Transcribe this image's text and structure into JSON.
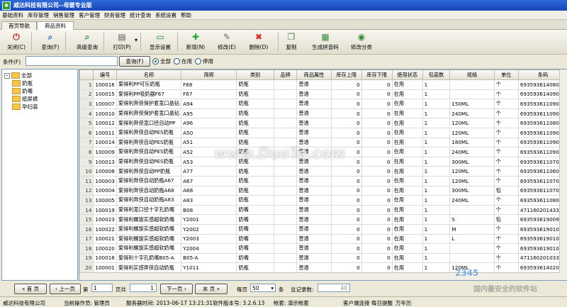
{
  "window": {
    "title": "威达科技有限公司--母婴专业版"
  },
  "menu": [
    "基础资料",
    "库存管理",
    "销售管理",
    "客户管理",
    "财务管理",
    "统计查询",
    "系统设置",
    "帮助"
  ],
  "tabs": [
    "首页导航",
    "商品资料"
  ],
  "toolbar": [
    {
      "label": "关闭(C)",
      "icon": "close-icon",
      "color": "#c0282a"
    },
    {
      "label": "查询(F)",
      "icon": "search-icon",
      "color": "#2f6fb5"
    },
    {
      "label": "高级查询",
      "icon": "advanced-search-icon",
      "color": "#2e9b45"
    },
    {
      "label": "打印(P)",
      "icon": "printer-icon",
      "color": "#555555"
    },
    {
      "label": "显示设置",
      "icon": "display-settings-icon",
      "color": "#2a8a3a"
    },
    {
      "label": "新增(N)",
      "icon": "add-icon",
      "color": "#26a03a"
    },
    {
      "label": "修改(E)",
      "icon": "edit-icon",
      "color": "#6a6a6a"
    },
    {
      "label": "删除(D)",
      "icon": "delete-icon",
      "color": "#d02a2a"
    },
    {
      "label": "复制",
      "icon": "copy-icon",
      "color": "#5a7a5a"
    },
    {
      "label": "生成拼音码",
      "icon": "pinyin-code-icon",
      "color": "#3a8a3a"
    },
    {
      "label": "修改分类",
      "icon": "modify-category-icon",
      "color": "#3a8a3a"
    }
  ],
  "condition": {
    "label": "条件(F)",
    "input_value": "",
    "query_button": "查询(F)",
    "radios": [
      "全部",
      "在用",
      "停用"
    ],
    "selected": 0
  },
  "tree": {
    "root": "全部",
    "children": [
      "奶瓶",
      "奶嘴",
      "纸尿裤",
      "孕妇装"
    ]
  },
  "table": {
    "columns": [
      "",
      "编号",
      "名称",
      "简称",
      "类别",
      "品牌",
      "商品属性",
      "库存上限",
      "库存下限",
      "使用状态",
      "包装数",
      "规格",
      "单位",
      "条码"
    ],
    "rows": [
      [
        "1",
        "100016",
        "爱得利PP可乐奶瓶",
        "F68",
        "奶瓶",
        "",
        "普通",
        "0",
        "0",
        "在用",
        "1",
        "",
        "个",
        "693593614080"
      ],
      [
        "2",
        "100015",
        "爱得利PP吸奶器F67",
        "F67",
        "奶瓶",
        "",
        "普通",
        "0",
        "0",
        "在用",
        "1",
        "",
        "个",
        "693593614090"
      ],
      [
        "3",
        "100007",
        "爱得利奔侠保护套宽口晶钻",
        "A94",
        "奶瓶",
        "",
        "普通",
        "0",
        "0",
        "在用",
        "1",
        "150ML",
        "个",
        "693593611090"
      ],
      [
        "4",
        "100010",
        "爱得利奔侠保护套宽口晶钻",
        "A95",
        "奶瓶",
        "",
        "普通",
        "0",
        "0",
        "在用",
        "1",
        "240ML",
        "个",
        "693593611090"
      ],
      [
        "5",
        "100012",
        "爱得利奔侠宽口径自动PP",
        "A96",
        "奶瓶",
        "",
        "普通",
        "0",
        "0",
        "在用",
        "1",
        "120ML",
        "个",
        "693593611080"
      ],
      [
        "6",
        "100011",
        "爱得利奔侠自动PES奶瓶",
        "A50",
        "奶瓶",
        "",
        "普通",
        "0",
        "0",
        "在用",
        "1",
        "120ML",
        "个",
        "693593611090"
      ],
      [
        "7",
        "100014",
        "爱得利奔侠自动PES奶瓶",
        "A51",
        "奶瓶",
        "",
        "普通",
        "0",
        "0",
        "在用",
        "1",
        "180ML",
        "个",
        "693593611090"
      ],
      [
        "8",
        "100009",
        "爱得利奔侠自动PES奶瓶",
        "A52",
        "奶瓶",
        "",
        "普通",
        "0",
        "0",
        "在用",
        "1",
        "240ML",
        "个",
        "693593611090"
      ],
      [
        "9",
        "100013",
        "爱得利奔侠自动PES奶瓶",
        "A53",
        "奶瓶",
        "",
        "普通",
        "0",
        "0",
        "在用",
        "1",
        "300ML",
        "个",
        "693593611070"
      ],
      [
        "10",
        "100008",
        "爱得利奔侠自动PP奶瓶",
        "A77",
        "奶瓶",
        "",
        "普通",
        "0",
        "0",
        "在用",
        "1",
        "120ML",
        "个",
        "693593611060"
      ],
      [
        "11",
        "100003",
        "爱得利奔侠自动奶瓶A67",
        "A67",
        "奶瓶",
        "",
        "普通",
        "0",
        "0",
        "在用",
        "1",
        "120ML",
        "个",
        "693593611070"
      ],
      [
        "12",
        "100004",
        "爱得利奔侠自动奶瓶A68",
        "A68",
        "奶瓶",
        "",
        "普通",
        "0",
        "0",
        "在用",
        "1",
        "300ML",
        "包",
        "693593611070"
      ],
      [
        "13",
        "100005",
        "爱得利奔侠自动奶瓶A83",
        "A83",
        "奶瓶",
        "",
        "普通",
        "0",
        "0",
        "在用",
        "1",
        "240ML",
        "个",
        "693593611080"
      ],
      [
        "14",
        "100019",
        "爱得利宽口径十字孔奶嘴",
        "B08",
        "奶嘴",
        "",
        "普通",
        "0",
        "0",
        "在用",
        "1",
        "",
        "个",
        "471160201433"
      ],
      [
        "15",
        "100023",
        "爱得利螺旋实感超软奶嘴",
        "Y2001",
        "奶嘴",
        "",
        "普通",
        "0",
        "0",
        "在用",
        "1",
        "S",
        "包",
        "693593619009"
      ],
      [
        "16",
        "100022",
        "爱得利螺旋实感超软奶嘴",
        "Y2002",
        "奶嘴",
        "",
        "普通",
        "0",
        "0",
        "在用",
        "1",
        "M",
        "个",
        "693593619010"
      ],
      [
        "17",
        "100021",
        "爱得利螺旋实感超软奶嘴",
        "Y2003",
        "奶嘴",
        "",
        "普通",
        "0",
        "0",
        "在用",
        "1",
        "L",
        "个",
        "693593619010"
      ],
      [
        "18",
        "100020",
        "爱得利螺旋实感超软奶嘴",
        "Y2004",
        "奶嘴",
        "",
        "普通",
        "0",
        "0",
        "在用",
        "1",
        "",
        "个",
        "693593619010"
      ],
      [
        "19",
        "100018",
        "爱得利十字孔奶嘴B05-A",
        "B05-A",
        "奶嘴",
        "",
        "普通",
        "0",
        "0",
        "在用",
        "1",
        "",
        "个",
        "471160201033"
      ],
      [
        "20",
        "100001",
        "爱得利实感奔侠自动奶瓶",
        "Y1011",
        "奶瓶",
        "",
        "普通",
        "0",
        "0",
        "在用",
        "1",
        "120ML",
        "个",
        "693593614020"
      ],
      [
        "21",
        "100006",
        "爱得利实感奔侠自动奶瓶",
        "Y1012",
        "奶瓶",
        "",
        "普通",
        "0",
        "0",
        "在用",
        "1",
        "300ML",
        "个",
        "693593614040"
      ]
    ]
  },
  "pager": {
    "first": "首 页",
    "prev": "上一页",
    "page_label": "第",
    "page_value": "1",
    "total_label": "页共",
    "total_value": "1",
    "next": "下一页",
    "last": "末 页",
    "per_page_label": "每页",
    "per_page_value": "50",
    "per_page_unit": "条",
    "record_label": "总记录数:",
    "record_value": "40"
  },
  "status": {
    "company": "威达科技有限公司",
    "operator": "当前操作员:   管理员",
    "server_time": "服务器时间:   2013-06-17 13:21:31",
    "version": "软件版本号:   3.2.6.13",
    "account": "帐套:   演示帐套",
    "online": "客户端连接",
    "reminder": "每日提醒",
    "calendar": "万年历"
  },
  "watermarks": {
    "center": "www.DuoTe.com",
    "corner_brand": "2345",
    "corner_text": "国内最安全的软件站"
  }
}
